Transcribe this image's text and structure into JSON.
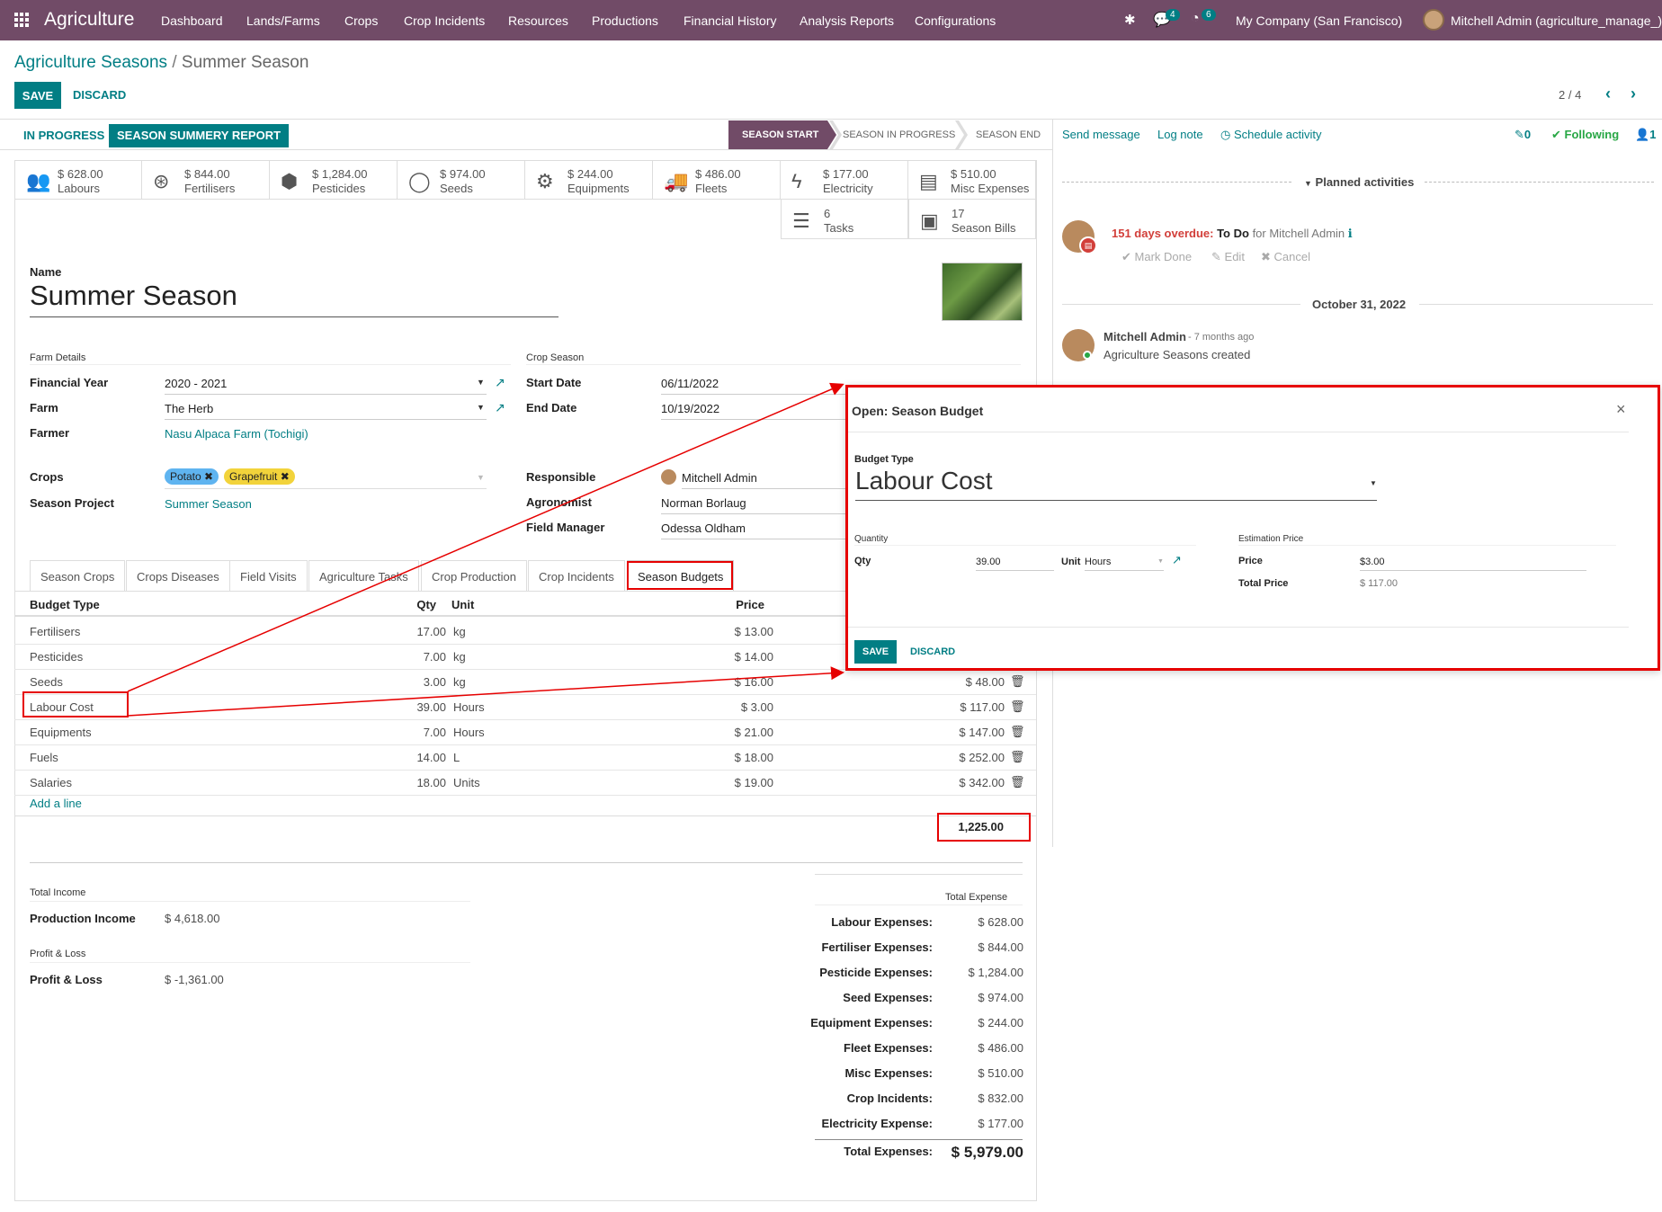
{
  "navbar": {
    "app_name": "Agriculture",
    "menus": [
      "Dashboard",
      "Lands/Farms",
      "Crops",
      "Crop Incidents",
      "Resources",
      "Productions",
      "Financial History",
      "Analysis Reports",
      "Configurations"
    ],
    "messages_count": "4",
    "activities_count": "6",
    "company": "My Company (San Francisco)",
    "user": "Mitchell Admin (agriculture_manage_)"
  },
  "breadcrumb": {
    "parent": "Agriculture Seasons",
    "separator": "/",
    "current": "Summer Season"
  },
  "actions": {
    "save": "SAVE",
    "discard": "DISCARD"
  },
  "pager": {
    "value": "2 / 4"
  },
  "header_buttons": {
    "in_progress": "IN PROGRESS",
    "report": "SEASON SUMMERY REPORT"
  },
  "statusbar": [
    "SEASON START",
    "SEASON IN PROGRESS",
    "SEASON END"
  ],
  "chatter": {
    "send_message": "Send message",
    "log_note": "Log note",
    "schedule_activity": "Schedule activity",
    "attachments": "0",
    "following": "Following",
    "followers": "1",
    "planned_activities": "Planned activities",
    "overdue": "151 days overdue:",
    "activity_type": "To Do",
    "activity_for": "for Mitchell Admin",
    "mark_done": "Mark Done",
    "edit": "Edit",
    "cancel": "Cancel",
    "date_separator": "October 31, 2022",
    "message_author": "Mitchell Admin",
    "message_time": "- 7 months ago",
    "message_body": "Agriculture Seasons created"
  },
  "stat_buttons": [
    {
      "value": "$ 628.00",
      "label": "Labours",
      "icon": "users-icon"
    },
    {
      "value": "$ 844.00",
      "label": "Fertilisers",
      "icon": "lifebuoy-icon"
    },
    {
      "value": "$ 1,284.00",
      "label": "Pesticides",
      "icon": "cubes-icon"
    },
    {
      "value": "$ 974.00",
      "label": "Seeds",
      "icon": "seed-icon"
    },
    {
      "value": "$ 244.00",
      "label": "Equipments",
      "icon": "gears-icon"
    },
    {
      "value": "$ 486.00",
      "label": "Fleets",
      "icon": "truck-icon"
    },
    {
      "value": "$ 177.00",
      "label": "Electricity",
      "icon": "bolt-icon"
    },
    {
      "value": "$ 510.00",
      "label": "Misc Expenses",
      "icon": "file-icon"
    },
    {
      "value": "6",
      "label": "Tasks",
      "icon": "tasks-icon"
    },
    {
      "value": "17",
      "label": "Season Bills",
      "icon": "money-icon"
    }
  ],
  "form": {
    "name_label": "Name",
    "name": "Summer Season",
    "farm_details_title": "Farm Details",
    "financial_year_label": "Financial Year",
    "financial_year": "2020 - 2021",
    "farm_label": "Farm",
    "farm": "The Herb",
    "farmer_label": "Farmer",
    "farmer": "Nasu Alpaca Farm (Tochigi)",
    "crops_label": "Crops",
    "crops": [
      "Potato",
      "Grapefruit"
    ],
    "season_project_label": "Season Project",
    "season_project": "Summer Season",
    "crop_season_title": "Crop Season",
    "start_date_label": "Start Date",
    "start_date": "06/11/2022",
    "end_date_label": "End Date",
    "end_date": "10/19/2022",
    "responsible_label": "Responsible",
    "responsible": "Mitchell Admin",
    "agronomist_label": "Agronomist",
    "agronomist": "Norman Borlaug",
    "field_manager_label": "Field Manager",
    "field_manager": "Odessa Oldham"
  },
  "tabs": [
    "Season Crops",
    "Crops Diseases",
    "Field Visits",
    "Agriculture Tasks",
    "Crop Production",
    "Crop Incidents",
    "Season Budgets"
  ],
  "budget_table": {
    "headers": {
      "type": "Budget Type",
      "qty": "Qty",
      "unit": "Unit",
      "price": "Price"
    },
    "rows": [
      {
        "type": "Fertilisers",
        "qty": "17.00",
        "unit": "kg",
        "price": "$ 13.00",
        "total": ""
      },
      {
        "type": "Pesticides",
        "qty": "7.00",
        "unit": "kg",
        "price": "$ 14.00",
        "total": ""
      },
      {
        "type": "Seeds",
        "qty": "3.00",
        "unit": "kg",
        "price": "$ 16.00",
        "total": "$ 48.00"
      },
      {
        "type": "Labour Cost",
        "qty": "39.00",
        "unit": "Hours",
        "price": "$ 3.00",
        "total": "$ 117.00"
      },
      {
        "type": "Equipments",
        "qty": "7.00",
        "unit": "Hours",
        "price": "$ 21.00",
        "total": "$ 147.00"
      },
      {
        "type": "Fuels",
        "qty": "14.00",
        "unit": "L",
        "price": "$ 18.00",
        "total": "$ 252.00"
      },
      {
        "type": "Salaries",
        "qty": "18.00",
        "unit": "Units",
        "price": "$ 19.00",
        "total": "$ 342.00"
      }
    ],
    "add_line": "Add a line",
    "grand_total": "1,225.00"
  },
  "income": {
    "total_income_title": "Total Income",
    "production_income_label": "Production Income",
    "production_income": "$ 4,618.00",
    "profit_loss_title": "Profit & Loss",
    "profit_loss_label": "Profit & Loss",
    "profit_loss": "$ -1,361.00"
  },
  "expenses": {
    "title": "Total Expense",
    "rows": [
      {
        "label": "Labour Expenses:",
        "value": "$ 628.00"
      },
      {
        "label": "Fertiliser Expenses:",
        "value": "$ 844.00"
      },
      {
        "label": "Pesticide Expenses:",
        "value": "$ 1,284.00"
      },
      {
        "label": "Seed Expenses:",
        "value": "$ 974.00"
      },
      {
        "label": "Equipment Expenses:",
        "value": "$ 244.00"
      },
      {
        "label": "Fleet Expenses:",
        "value": "$ 486.00"
      },
      {
        "label": "Misc Expenses:",
        "value": "$ 510.00"
      },
      {
        "label": "Crop Incidents:",
        "value": "$ 832.00"
      },
      {
        "label": "Electricity Expense:",
        "value": "$ 177.00"
      }
    ],
    "total_label": "Total Expenses:",
    "total_value": "$ 5,979.00"
  },
  "dialog": {
    "title": "Open: Season Budget",
    "close": "×",
    "budget_type_label": "Budget Type",
    "budget_type": "Labour Cost",
    "quantity_title": "Quantity",
    "qty_label": "Qty",
    "qty": "39.00",
    "unit_label": "Unit",
    "unit": "Hours",
    "estimation_title": "Estimation Price",
    "price_label": "Price",
    "price": "$3.00",
    "total_price_label": "Total Price",
    "total_price": "$ 117.00",
    "save": "SAVE",
    "discard": "DISCARD"
  },
  "colors": {
    "brand": "#714b67",
    "accent": "#017e84",
    "highlight": "#e60000",
    "overdue": "#d23f3a"
  }
}
